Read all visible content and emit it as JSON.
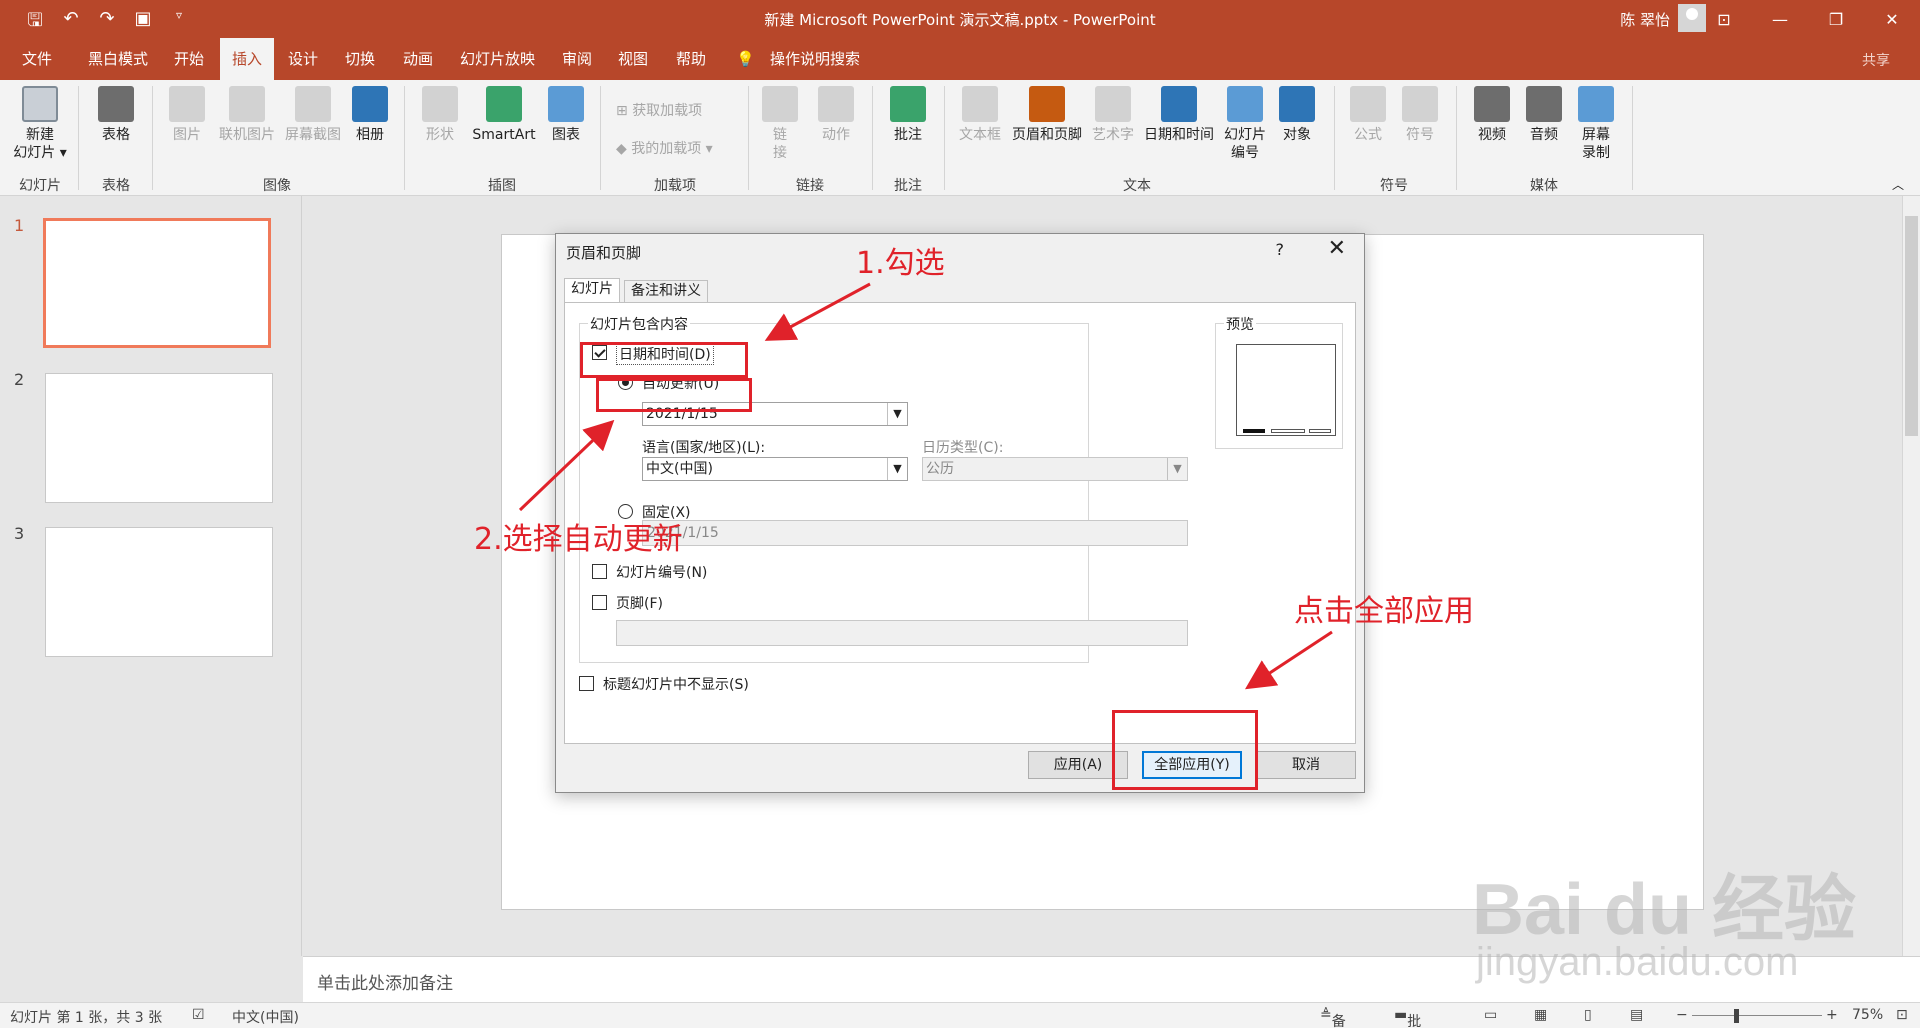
{
  "window": {
    "title": "新建 Microsoft PowerPoint 演示文稿.pptx  -  PowerPoint",
    "user": "陈 翠怡",
    "share": "共享"
  },
  "tabs": [
    "文件",
    "黑白模式",
    "开始",
    "插入",
    "设计",
    "切换",
    "动画",
    "幻灯片放映",
    "审阅",
    "视图",
    "帮助",
    "操作说明搜索"
  ],
  "active_tab": "插入",
  "ribbon": {
    "new_slide": "新建\n幻灯片 ▾",
    "table": "表格",
    "picture": "图片",
    "online_picture": "联机图片",
    "screenshot": "屏幕截图",
    "album": "相册",
    "shapes": "形状",
    "smartart": "SmartArt",
    "chart": "图表",
    "get_addins": "获取加载项",
    "my_addins": "我的加载项",
    "link": "链\n接",
    "action": "动作",
    "comment": "批注",
    "textbox": "文本框",
    "header_footer": "页眉和页脚",
    "wordart": "艺术字",
    "date_time": "日期和时间",
    "slide_number": "幻灯片\n编号",
    "object": "对象",
    "equation": "公式",
    "symbol": "符号",
    "video": "视频",
    "audio": "音频",
    "screen_record": "屏幕\n录制",
    "groups": {
      "slides": "幻灯片",
      "tables": "表格",
      "images": "图像",
      "illustrations": "插图",
      "addins": "加载项",
      "links": "链接",
      "comments": "批注",
      "text": "文本",
      "symbols": "符号",
      "media": "媒体"
    }
  },
  "slides": [
    "1",
    "2",
    "3"
  ],
  "notes_placeholder": "单击此处添加备注",
  "status": {
    "slide_info": "幻灯片 第 1 张，共 3 张",
    "language": "中文(中国)",
    "notes": "备注",
    "comments": "批注",
    "zoom": "75%"
  },
  "dialog": {
    "title": "页眉和页脚",
    "help": "?",
    "tab_slide": "幻灯片",
    "tab_notes": "备注和讲义",
    "group_label": "幻灯片包含内容",
    "date_time": "日期和时间(D)",
    "auto_update": "自动更新(U)",
    "date_value": "2021/1/15",
    "language_label": "语言(国家/地区)(L):",
    "language_value": "中文(中国)",
    "calendar_label": "日历类型(C):",
    "calendar_value": "公历",
    "fixed": "固定(X)",
    "fixed_value": "2021/1/15",
    "slide_number": "幻灯片编号(N)",
    "footer": "页脚(F)",
    "dont_show_title": "标题幻灯片中不显示(S)",
    "preview": "预览",
    "apply": "应用(A)",
    "apply_all": "全部应用(Y)",
    "cancel": "取消",
    "date_checked": true,
    "auto_update_selected": true
  },
  "annotations": {
    "step1": "1.勾选",
    "step2": "2.选择自动更新",
    "step3": "点击全部应用",
    "color": "#e0222a"
  },
  "watermark": {
    "brand": "Bai du 经验",
    "url": "jingyan.baidu.com"
  },
  "colors": {
    "accent": "#b7472a",
    "selected_slide_border": "#f07a5a"
  }
}
